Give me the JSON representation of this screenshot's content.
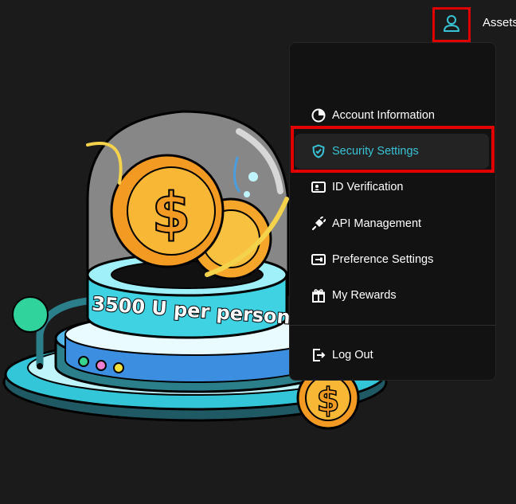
{
  "header": {
    "assets_label": "Assets"
  },
  "icons": {
    "user": "user-icon",
    "account": "pie-chart-icon",
    "security": "shield-icon",
    "id": "id-card-icon",
    "api": "plug-icon",
    "preference": "settings-toggle-icon",
    "rewards": "gift-icon",
    "logout": "logout-icon"
  },
  "menu": {
    "items": [
      {
        "label": "Account Information"
      },
      {
        "label": "Security Settings",
        "active": true
      },
      {
        "label": "ID Verification"
      },
      {
        "label": "API Management"
      },
      {
        "label": "Preference Settings"
      },
      {
        "label": "My Rewards"
      }
    ],
    "logout_label": "Log Out"
  },
  "promo": {
    "banner_text": "3500 U per person"
  },
  "colors": {
    "accent": "#38c4d6",
    "highlight": "#e00000",
    "background": "#1b1b1b",
    "menu_bg": "#121212"
  }
}
